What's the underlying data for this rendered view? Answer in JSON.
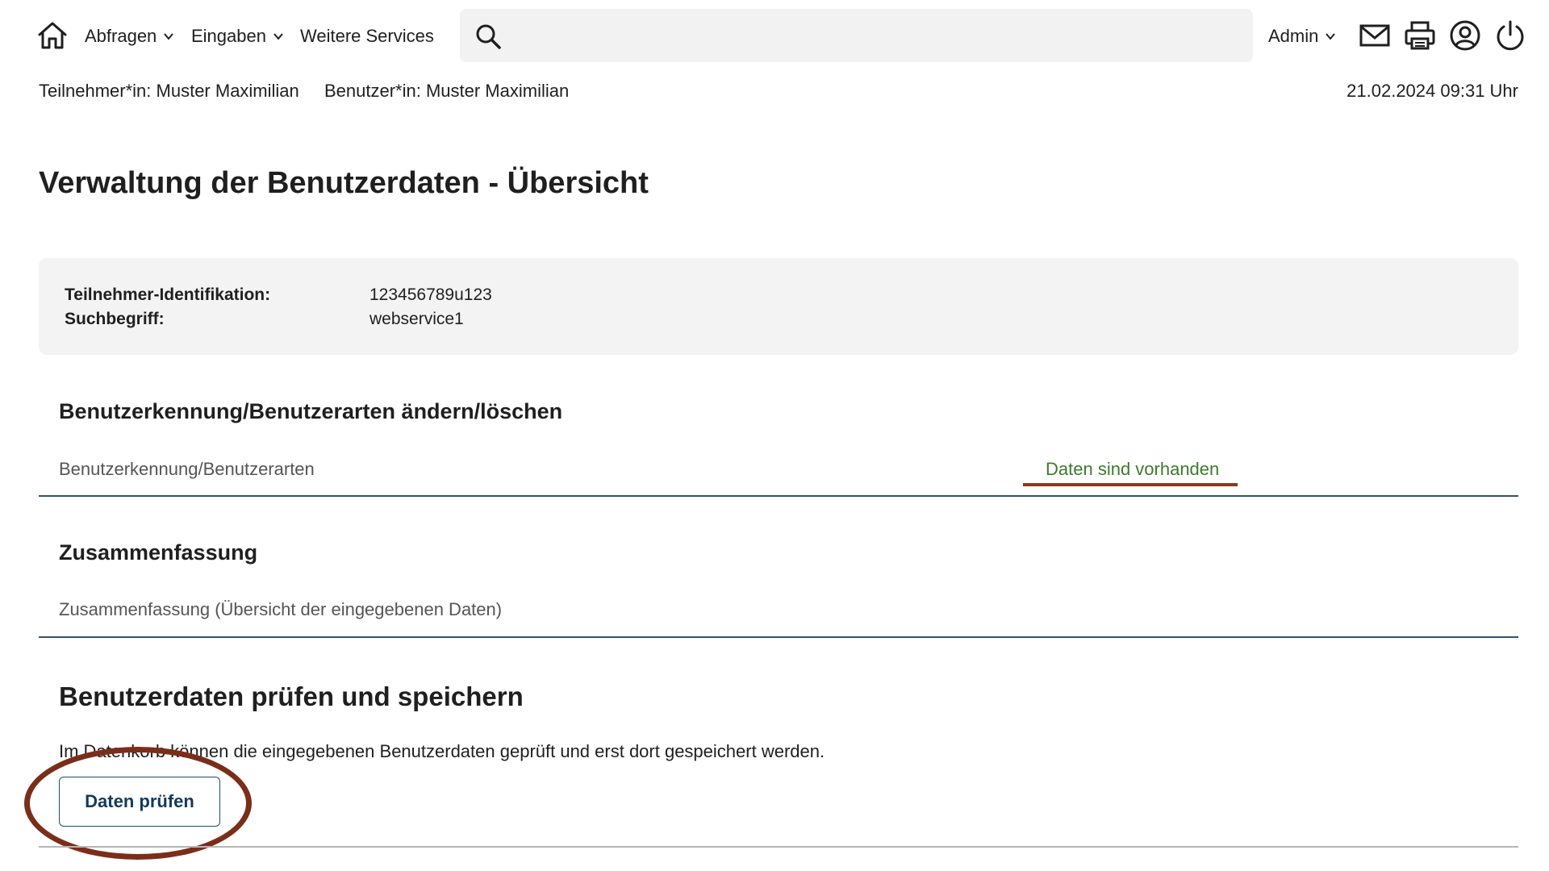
{
  "nav": {
    "items": [
      {
        "label": "Abfragen",
        "has_dropdown": true
      },
      {
        "label": "Eingaben",
        "has_dropdown": true
      },
      {
        "label": "Weitere Services",
        "has_dropdown": false
      }
    ],
    "search": {
      "value": "",
      "placeholder": ""
    },
    "admin_label": "Admin",
    "icons": [
      "home-icon",
      "search-icon",
      "chevron-down-icon",
      "mail-icon",
      "print-icon",
      "user-icon",
      "power-icon"
    ]
  },
  "info_line": {
    "participant": "Teilnehmer*in:  Muster Maximilian",
    "user": "Benutzer*in:  Muster Maximilian",
    "datetime": "21.02.2024  09:31 Uhr"
  },
  "page_title": "Verwaltung der Benutzerdaten - Übersicht",
  "info_panel": {
    "id_label": "Teilnehmer-Identifikation:",
    "id_value": "123456789u123",
    "search_label": "Suchbegriff:",
    "search_value": "webservice1"
  },
  "sections": {
    "change": {
      "title": "Benutzerkennung/Benutzerarten ändern/löschen",
      "row_label": "Benutzerkennung/Benutzerarten",
      "row_status": "Daten sind vorhanden"
    },
    "summary": {
      "title": "Zusammenfassung",
      "row_label": "Zusammenfassung (Übersicht der eingegebenen Daten)"
    },
    "check": {
      "title": "Benutzerdaten prüfen und speichern",
      "description": "Im Datenkorb können die eingegebenen Benutzerdaten geprüft und erst dort gespeichert werden.",
      "button_label": "Daten prüfen"
    }
  },
  "colors": {
    "status_green": "#3d7a2c",
    "accent_underline": "#8a3a1e",
    "highlight": "#7a2e1a",
    "button_text": "#123a5c",
    "divider": "#31536b"
  }
}
